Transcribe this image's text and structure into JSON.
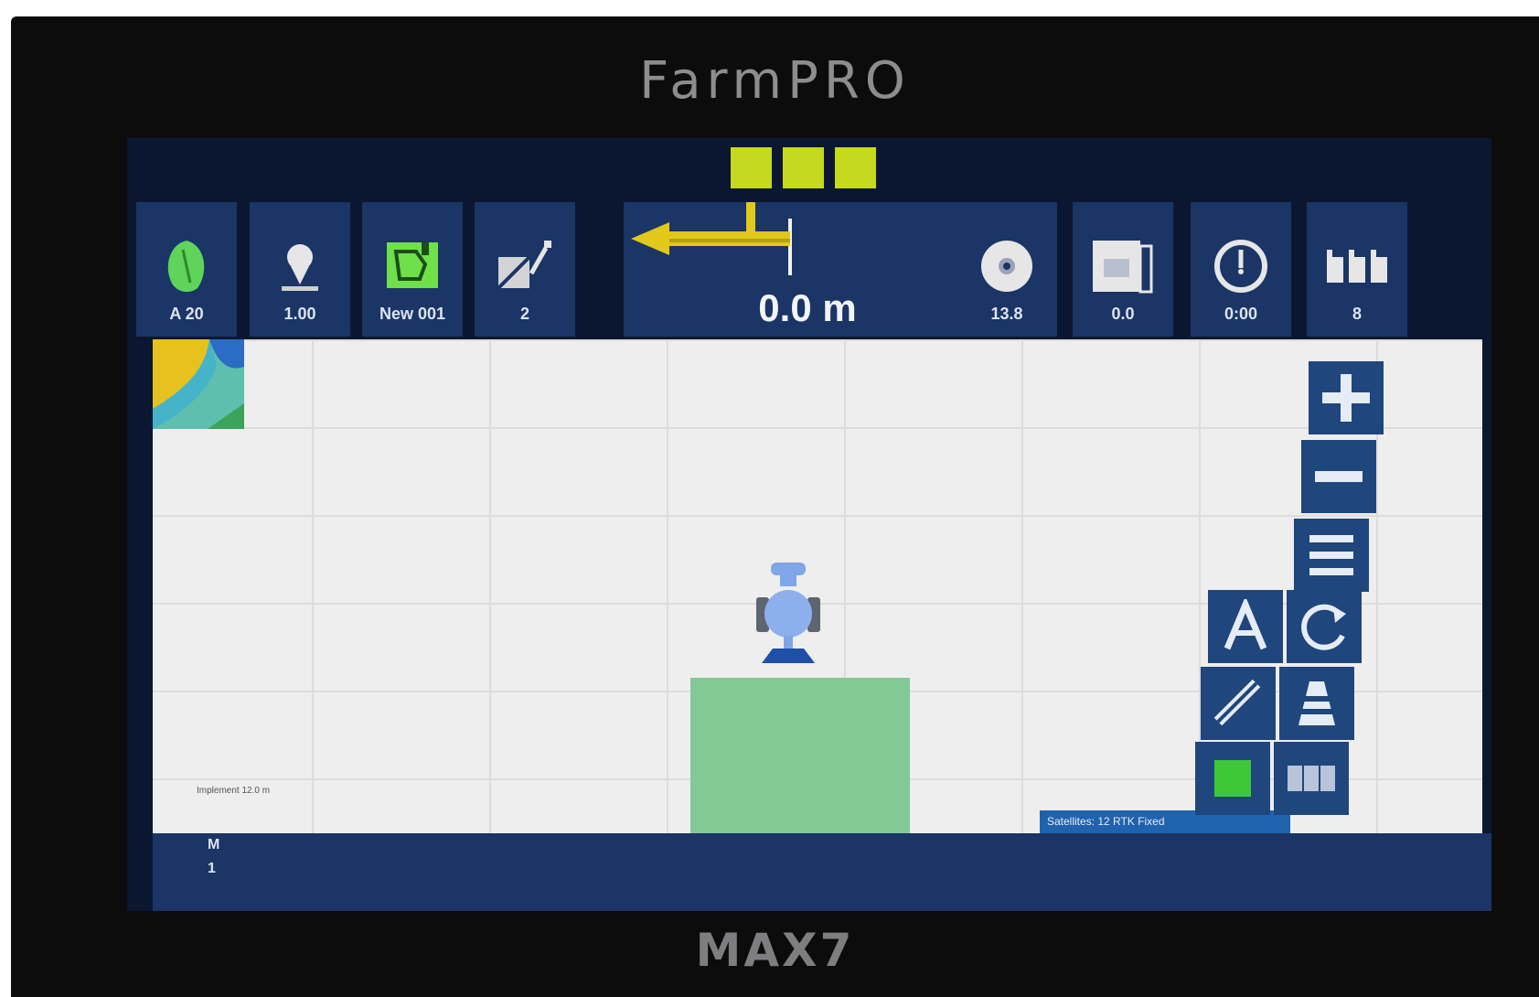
{
  "device": {
    "brand": "FarmPRO",
    "model": "MAX7"
  },
  "colors": {
    "toolbar_bg": "#1a3566",
    "screen_bg": "#0b1730",
    "status_green": "#c5d91e",
    "coverage_green": "#82c996",
    "guidance_arrow": "#e2c81a",
    "map_button": "#1f467d"
  },
  "status_indicators": [
    "status-1",
    "status-2",
    "status-3"
  ],
  "toolbar": {
    "left": [
      {
        "icon": "field-icon",
        "value": "A 20"
      },
      {
        "icon": "location-icon",
        "value": "1.00"
      },
      {
        "icon": "field-boundary-icon",
        "value": "New 001"
      },
      {
        "icon": "steering-icon",
        "value": "2"
      }
    ],
    "right": [
      {
        "icon": "speed-icon",
        "value": "13.8"
      },
      {
        "icon": "document-icon",
        "value": "0.0"
      },
      {
        "icon": "timer-icon",
        "value": "0:00"
      },
      {
        "icon": "sections-icon",
        "value": "8"
      }
    ]
  },
  "guidance": {
    "direction": "left",
    "distance": "0.0 m"
  },
  "map": {
    "scale_label": "Implement 12.0 m",
    "status_text": "Satellites: 12 RTK Fixed"
  },
  "map_buttons": [
    {
      "name": "zoom-in-button",
      "icon": "plus-icon"
    },
    {
      "name": "zoom-out-button",
      "icon": "minus-icon"
    },
    {
      "name": "menu-button",
      "icon": "menu-icon"
    },
    {
      "name": "ab-line-button",
      "icon": "letter-a-icon"
    },
    {
      "name": "camera-view-button",
      "icon": "rotate-view-icon"
    },
    {
      "name": "draw-line-button",
      "icon": "ruler-icon"
    },
    {
      "name": "boundary-button",
      "icon": "cone-icon"
    },
    {
      "name": "coverage-toggle-button",
      "icon": "green-square-icon"
    },
    {
      "name": "section-control-button",
      "icon": "sections-icon"
    }
  ],
  "bottom_bar": {
    "line1": "M",
    "line2": "1"
  }
}
